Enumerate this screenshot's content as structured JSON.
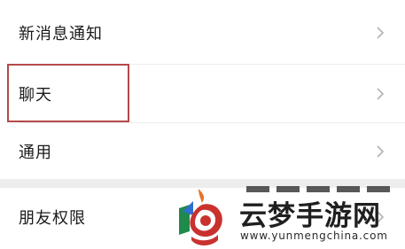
{
  "settings": {
    "group1": [
      {
        "label": "新消息通知",
        "icon": "chevron-right-icon"
      },
      {
        "label": "聊天",
        "icon": "chevron-right-icon"
      },
      {
        "label": "通用",
        "icon": "chevron-right-icon"
      }
    ],
    "group2": [
      {
        "label": "朋友权限",
        "icon": "chevron-right-icon"
      }
    ]
  },
  "annotation": {
    "highlight_color": "#b5494a",
    "highlighted_item": "聊天"
  },
  "watermark": {
    "title": "云梦手游网",
    "url": "www.yunmengchina.com"
  },
  "colors": {
    "background": "#ededed",
    "row_background": "#ffffff",
    "text": "#1a1a1a",
    "chevron": "#b3b3b3"
  }
}
